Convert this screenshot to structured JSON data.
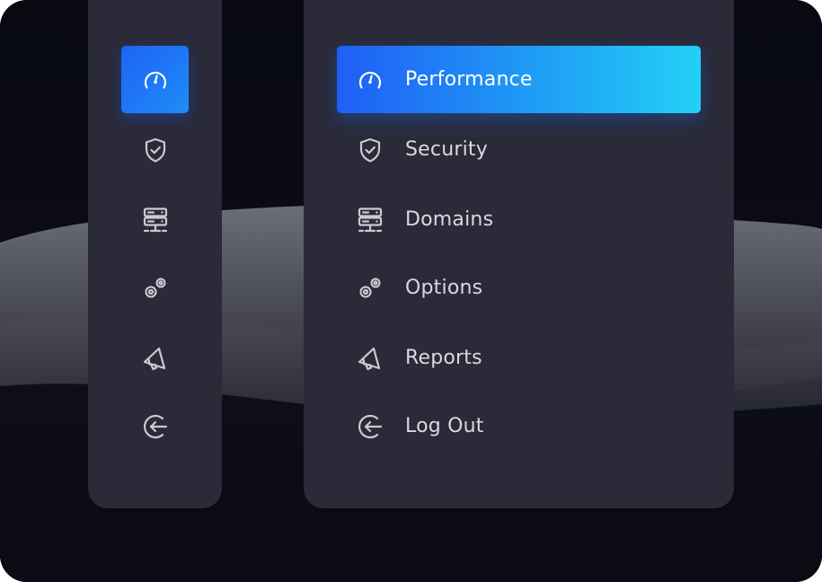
{
  "menu": {
    "items": [
      {
        "label": "Performance",
        "icon": "speedometer-icon",
        "active": true
      },
      {
        "label": "Security",
        "icon": "shield-check-icon",
        "active": false
      },
      {
        "label": "Domains",
        "icon": "server-icon",
        "active": false
      },
      {
        "label": "Options",
        "icon": "gears-icon",
        "active": false
      },
      {
        "label": "Reports",
        "icon": "megaphone-icon",
        "active": false
      },
      {
        "label": "Log Out",
        "icon": "logout-icon",
        "active": false
      }
    ]
  },
  "colors": {
    "panel": "#2a2a38",
    "background": "#0b0c15",
    "active_gradient_start": "#1f5ef5",
    "active_gradient_end": "#23d0f5",
    "icon": "#c9cad3",
    "text": "#d8d9e2"
  }
}
